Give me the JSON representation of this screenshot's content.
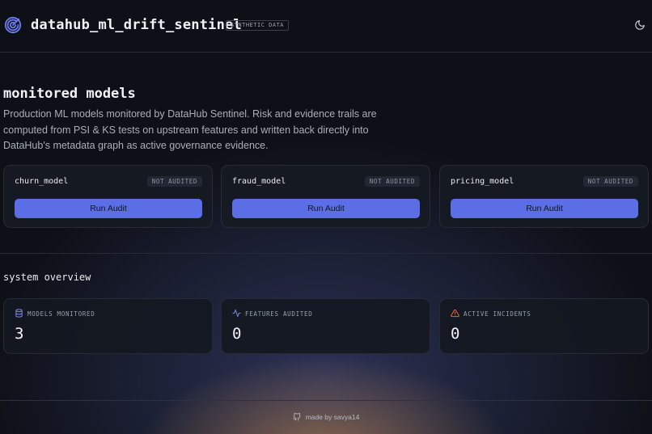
{
  "header": {
    "app_title": "datahub_ml_drift_sentinel",
    "badge": "SYNTHETIC DATA",
    "logo_icon": "radar-icon",
    "theme_icon": "moon-icon"
  },
  "intro": {
    "title": "monitored models",
    "description": "Production ML models monitored by DataHub Sentinel. Risk and evidence trails are computed from PSI & KS tests on upstream features and written back directly into DataHub's metadata graph as active governance evidence."
  },
  "models": [
    {
      "name": "churn_model",
      "status": "NOT AUDITED",
      "action": "Run Audit"
    },
    {
      "name": "fraud_model",
      "status": "NOT AUDITED",
      "action": "Run Audit"
    },
    {
      "name": "pricing_model",
      "status": "NOT AUDITED",
      "action": "Run Audit"
    }
  ],
  "overview": {
    "title": "system overview",
    "stats": [
      {
        "label": "MODELS MONITORED",
        "value": "3",
        "icon": "database-icon",
        "icon_color": "#7b86f0"
      },
      {
        "label": "FEATURES AUDITED",
        "value": "0",
        "icon": "activity-icon",
        "icon_color": "#7b86f0"
      },
      {
        "label": "ACTIVE INCIDENTS",
        "value": "0",
        "icon": "warning-icon",
        "icon_color": "#f06a3a"
      }
    ]
  },
  "footer": {
    "text": "made by savya14",
    "icon": "github-icon"
  },
  "colors": {
    "accent": "#5b6ee6",
    "background": "#0d1016",
    "warning": "#f06a3a"
  }
}
